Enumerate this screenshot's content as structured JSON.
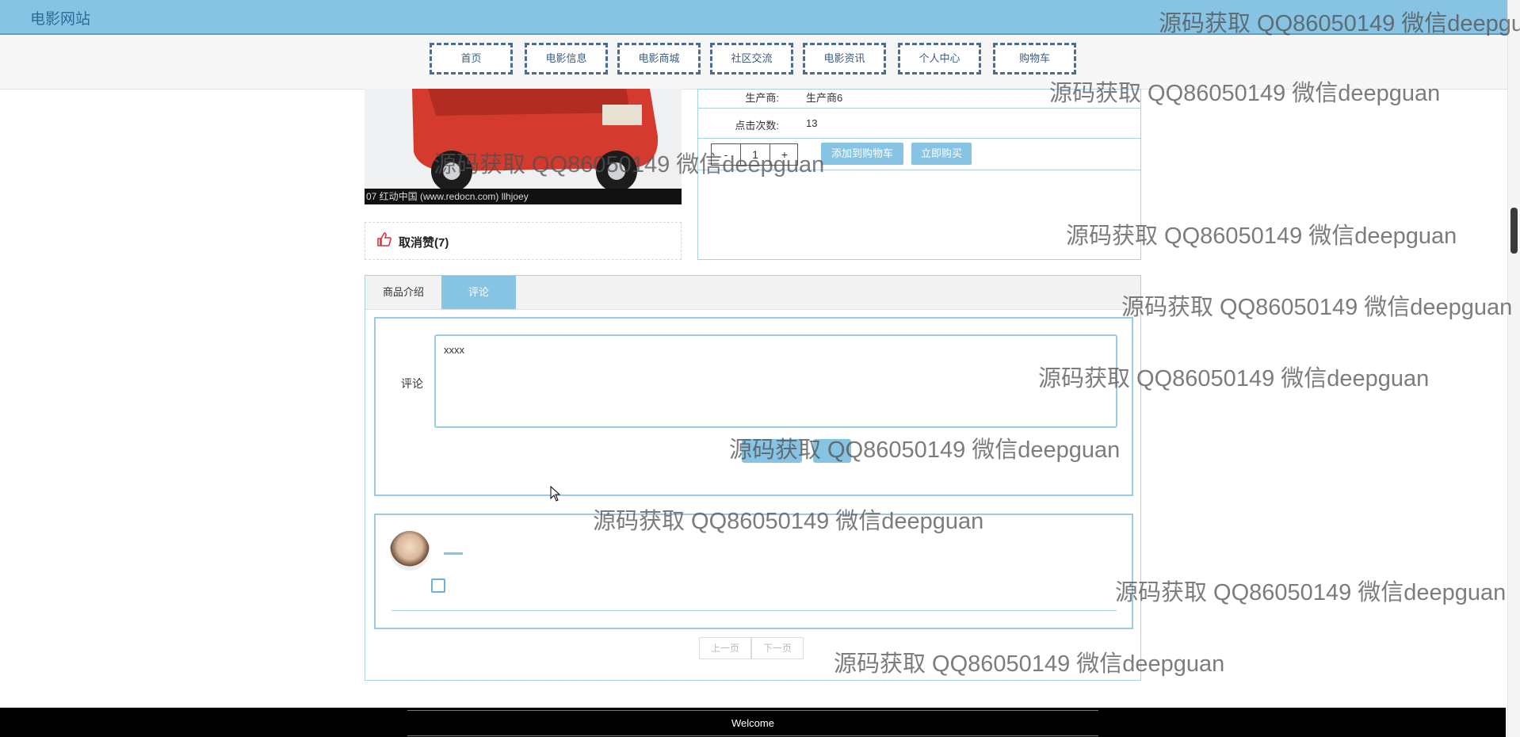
{
  "header": {
    "site_title": "电影网站"
  },
  "nav": {
    "items": [
      "首页",
      "电影信息",
      "电影商城",
      "社区交流",
      "电影资讯",
      "个人中心",
      "购物车"
    ]
  },
  "product": {
    "image_caption": "07    红动中国 (www.redocn.com)    llhjoey",
    "like_label": "取消赞(7)",
    "producer_label": "生产商:",
    "producer_value": "生产商6",
    "clicks_label": "点击次数:",
    "clicks_value": "13",
    "quantity": "1",
    "add_to_cart_label": "添加到购物车",
    "buy_now_label": "立即购买"
  },
  "tabs": [
    {
      "label": "商品介绍",
      "active": false
    },
    {
      "label": "评论",
      "active": true
    }
  ],
  "comment_form": {
    "label": "评论",
    "content": "xxxx"
  },
  "pagination": {
    "prev_label": "上一页",
    "next_label": "下一页"
  },
  "footer": {
    "text": "Welcome"
  },
  "watermark_text": "源码获取 QQ86050149 微信deepguan",
  "colors": {
    "accent": "#87c4e3",
    "nav_border": "#4c6c93",
    "like_icon": "#d9343a"
  }
}
